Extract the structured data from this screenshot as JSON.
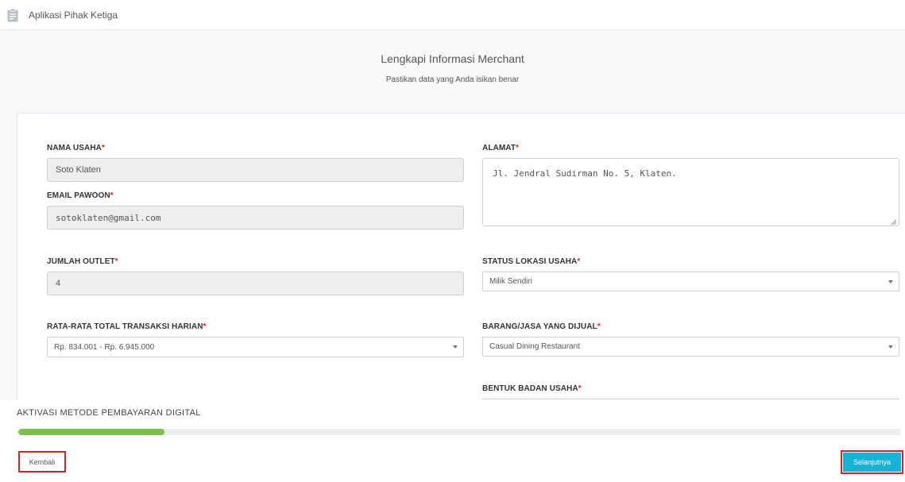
{
  "app": {
    "title": "Aplikasi Pihak Ketiga",
    "icon": "clipboard-icon"
  },
  "header": {
    "title": "Lengkapi Informasi Merchant",
    "subtitle": "Pastikan data yang Anda isikan benar"
  },
  "form": {
    "required_mark": "*",
    "nama_usaha": {
      "label": "NAMA USAHA",
      "value": "Soto Klaten"
    },
    "email": {
      "label": "EMAIL PAWOON",
      "value": "sotoklaten@gmail.com"
    },
    "jumlah_outlet": {
      "label": "JUMLAH OUTLET",
      "value": "4"
    },
    "transaksi": {
      "label": "RATA-RATA TOTAL TRANSAKSI HARIAN",
      "value": "Rp. 834.001 - Rp. 6.945.000"
    },
    "alamat": {
      "label": "ALAMAT",
      "value": "Jl. Jendral Sudirman No. 5, Klaten."
    },
    "status_lokasi": {
      "label": "STATUS LOKASI USAHA",
      "value": "Milik Sendiri"
    },
    "barang_jasa": {
      "label": "BARANG/JASA YANG DIJUAL",
      "value": "Casual Dining Restaurant"
    },
    "badan_usaha": {
      "label": "BENTUK BADAN USAHA"
    }
  },
  "footer": {
    "step_title": "AKTIVASI METODE PEMBAYARAN DIGITAL",
    "progress": 0.166,
    "back_label": "Kembali",
    "next_label": "Selanjutnya"
  },
  "colors": {
    "accent": "#17b3d4",
    "progress": "#7dc04b",
    "highlight": "#d1232a",
    "required": "#e02020"
  }
}
